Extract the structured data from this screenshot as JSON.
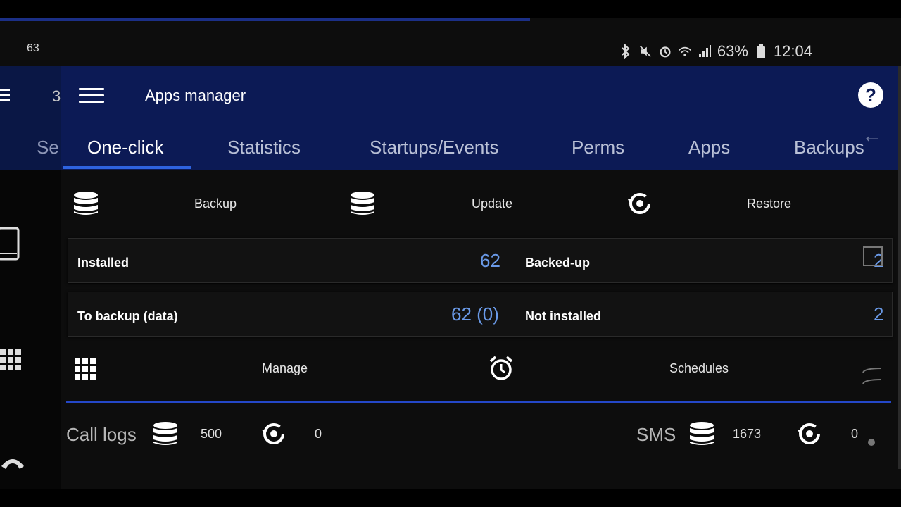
{
  "status_bar": {
    "left_number": "63",
    "battery": "63%",
    "time": "12:04"
  },
  "app_bar": {
    "title": "Apps manager",
    "help_glyph": "?"
  },
  "left_peek": {
    "tab_fragment": "Se",
    "title_fragment": "3"
  },
  "tabs": [
    {
      "label": "One-click",
      "active": true
    },
    {
      "label": "Statistics",
      "active": false
    },
    {
      "label": "Startups/Events",
      "active": false
    },
    {
      "label": "Perms",
      "active": false
    },
    {
      "label": "Apps",
      "active": false
    },
    {
      "label": "Backups",
      "active": false
    }
  ],
  "actions": {
    "backup": "Backup",
    "update": "Update",
    "restore": "Restore"
  },
  "stats": {
    "installed_label": "Installed",
    "installed_value": "62",
    "backed_up_label": "Backed-up",
    "backed_up_value": "2",
    "to_backup_label": "To backup (data)",
    "to_backup_value": "62 (0)",
    "not_installed_label": "Not installed",
    "not_installed_value": "2"
  },
  "tools": {
    "manage": "Manage",
    "schedules": "Schedules"
  },
  "bottom": {
    "call_logs_label": "Call logs",
    "call_logs_backup": "500",
    "call_logs_restore": "0",
    "sms_label": "SMS",
    "sms_backup": "1673",
    "sms_restore": "0"
  },
  "colors": {
    "app_bar": "#0c1a55",
    "accent": "#2e63e0",
    "value_blue": "#6a9ae8"
  }
}
